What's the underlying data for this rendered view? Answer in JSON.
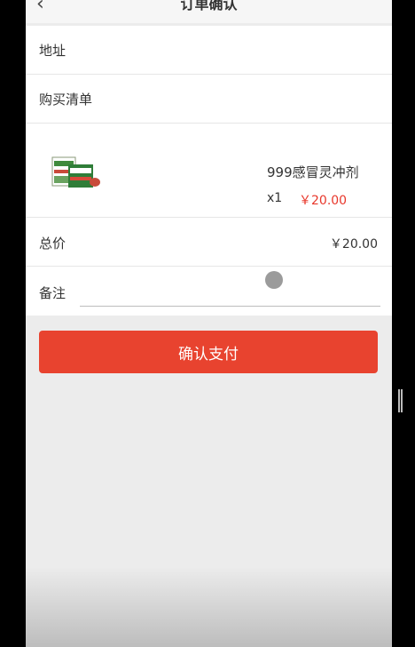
{
  "header": {
    "title": "订单确认",
    "back_icon": "‹"
  },
  "rows": {
    "address_label": "地址",
    "list_label": "购买清单",
    "total_label": "总价",
    "note_label": "备注"
  },
  "product": {
    "name": "999感冒灵冲剂",
    "quantity": "x1",
    "price": "￥20.00"
  },
  "total": {
    "value": "￥20.00"
  },
  "note": {
    "value": "",
    "placeholder": ""
  },
  "pay_button": {
    "label": "确认支付"
  },
  "colors": {
    "accent": "#e8432f",
    "price": "#e8372b",
    "background": "#ececec"
  }
}
